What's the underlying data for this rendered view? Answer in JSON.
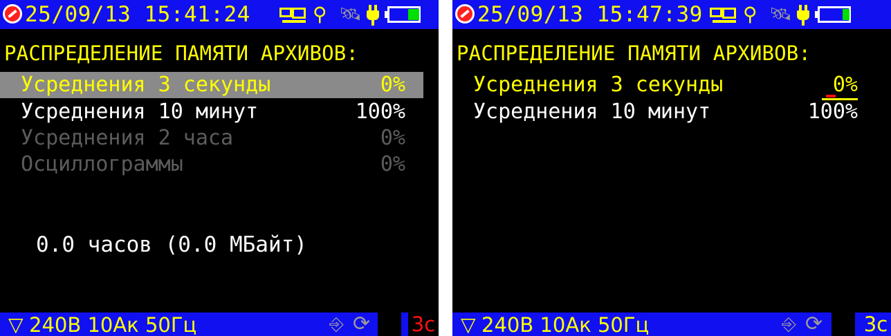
{
  "colors": {
    "background": "#000000",
    "bar": "#1010f0",
    "accent": "#ffff00",
    "selected_row": "#8a8a8a",
    "disabled_text": "#5c5c5c",
    "alert": "#ff1010",
    "battery": "#00e000"
  },
  "screens": [
    {
      "status_bar": {
        "datetime": "25/09/13 15:41:24",
        "icons": [
          "device-logo-icon",
          "pc-connection-icon",
          "usb-icon",
          "satellite-icon",
          "power-plug-icon",
          "battery-icon"
        ],
        "battery_level": 0.4
      },
      "heading": "РАСПРЕДЕЛЕНИЕ ПАМЯТИ АРХИВОВ:",
      "rows": [
        {
          "label": "Усреднения 3 секунды",
          "value": "0%",
          "state": "selected"
        },
        {
          "label": "Усреднения 10 минут",
          "value": "100%",
          "state": "normal"
        },
        {
          "label": "Усреднения 2 часа",
          "value": "0%",
          "state": "disabled"
        },
        {
          "label": "Осциллограммы",
          "value": "0%",
          "state": "disabled"
        }
      ],
      "summary": "0.0 часов (0.0 МБайт)",
      "bottom_bar": {
        "params": "240В 10Ак 50Гц",
        "interval": "3с",
        "icons": [
          "connection-scheme-icon",
          "recording-icon",
          "sync-icon"
        ]
      }
    },
    {
      "status_bar": {
        "datetime": "25/09/13 15:47:39",
        "icons": [
          "device-logo-icon",
          "pc-connection-icon",
          "usb-icon",
          "satellite-icon",
          "power-plug-icon",
          "battery-icon"
        ],
        "battery_level": 0.25
      },
      "heading": "РАСПРЕДЕЛЕНИЕ ПАМЯТИ АРХИВОВ:",
      "rows": [
        {
          "label": "Усреднения 3 секунды",
          "value": "0%",
          "state": "editing"
        },
        {
          "label": "Усреднения 10 минут",
          "value": "100%",
          "state": "normal"
        }
      ],
      "bottom_bar": {
        "params": "240В 10Ак 50Гц",
        "interval": "3с",
        "icons": [
          "connection-scheme-icon",
          "recording-icon",
          "sync-icon"
        ]
      }
    }
  ]
}
